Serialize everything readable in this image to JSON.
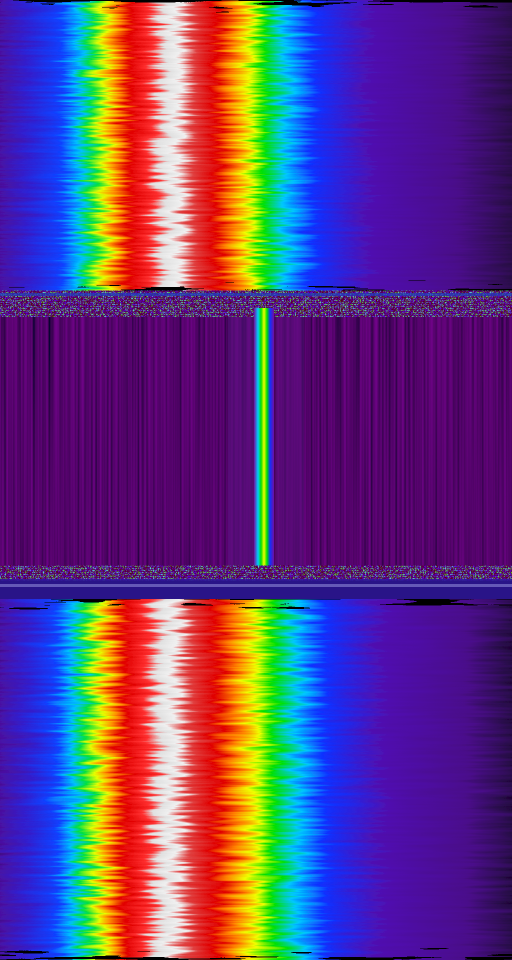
{
  "waterfall": {
    "colormap": [
      "#000000",
      "#3a0a5a",
      "#6a0fb0",
      "#1020ff",
      "#00c8ff",
      "#00e000",
      "#f0ff00",
      "#ff8000",
      "#e00000",
      "#e8e8e8"
    ],
    "background_color": "#000000",
    "quiet_color": "#140814",
    "signal": {
      "description_visible": false
    }
  }
}
